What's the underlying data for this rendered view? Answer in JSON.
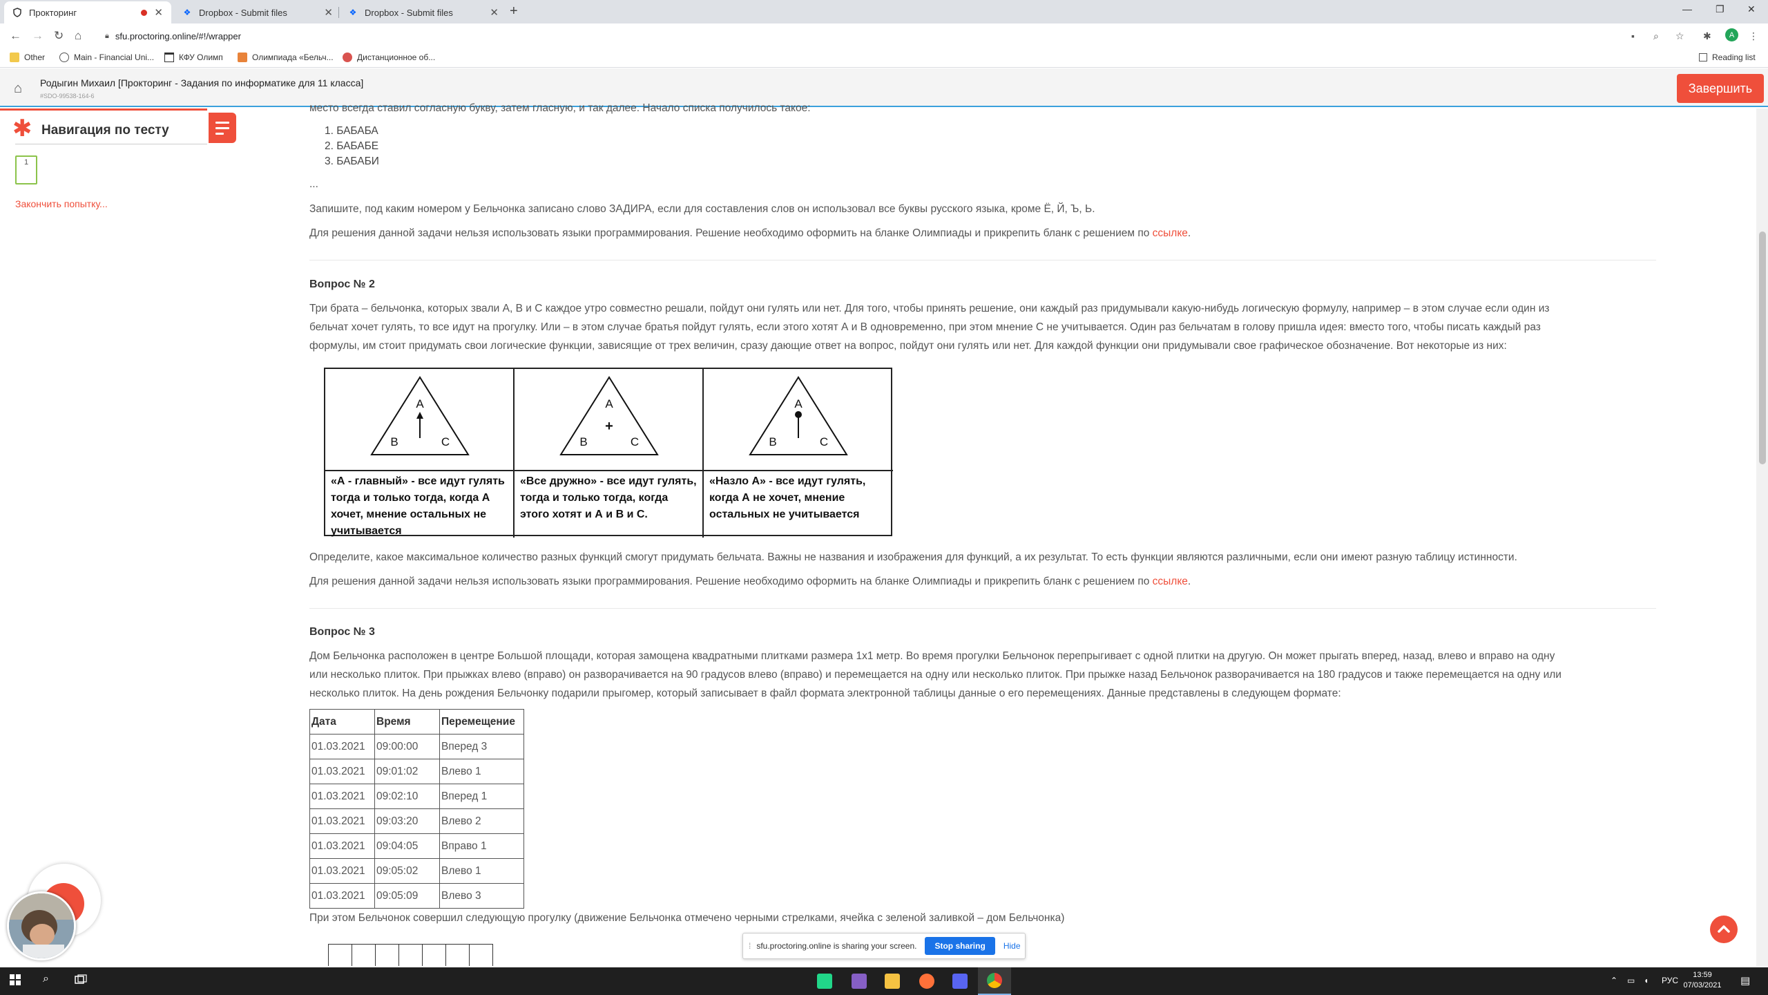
{
  "browser": {
    "tabs": [
      {
        "label": "Прокторинг",
        "icon": "shield-icon",
        "recording": true,
        "active": true
      },
      {
        "label": "Dropbox - Submit files",
        "icon": "dropbox-icon",
        "active": false
      },
      {
        "label": "Dropbox - Submit files",
        "icon": "dropbox-icon",
        "active": false
      }
    ],
    "url": "sfu.proctoring.online/#!/wrapper",
    "bookmarks": [
      {
        "label": "Other"
      },
      {
        "label": "Main - Financial Uni..."
      },
      {
        "label": "КФУ Олимп"
      },
      {
        "label": "Олимпиада «Бельч..."
      },
      {
        "label": "Дистанционное об..."
      }
    ],
    "reading_list": "Reading list",
    "profile_initial": "A"
  },
  "header": {
    "title": "Родыгин Михаил [Прокторинг - Задания по информатике для 11 класса]",
    "subtitle": "#SDO-99538-164-6",
    "finish_label": "Завершить"
  },
  "nav": {
    "title": "Навигация по тесту",
    "question_number": "1",
    "end_attempt": "Закончить попытку..."
  },
  "q1": {
    "intro_tail": "место всегда ставил согласную букву, затем гласную, и так далее. Начало списка получилось такое:",
    "list": [
      "1. БАБАБА",
      "2. БАБАБЕ",
      "3. БАБАБИ"
    ],
    "ellipsis": "...",
    "task": "Запишите, под каким номером у Бельчонка записано слово ЗАДИРА, если для составления слов он использовал все буквы русского языка, кроме Ё, Й, Ъ, Ь.",
    "note_prefix": "Для решения данной задачи нельзя использовать языки программирования. Решение необходимо оформить на бланке Олимпиады и прикрепить бланк с решением по ",
    "note_link": "ссылке",
    "note_suffix": "."
  },
  "q2": {
    "heading": "Вопрос № 2",
    "para_lines": [
      "Три брата – бельчонка, которых звали A, B и C каждое утро совместно решали, пойдут они гулять или нет. Для того, чтобы принять решение, они каждый раз придумывали какую-нибудь логическую формулу, например  – в этом случае если один из",
      "бельчат хочет гулять, то все идут на прогулку. Или  – в этом случае братья пойдут гулять, если этого хотят А и В одновременно, при этом мнение С не учитывается. Один раз бельчатам в голову пришла идея: вместо того, чтобы писать каждый раз",
      "формулы, им стоит придумать свои логические функции, зависящие от трех величин, сразу дающие ответ на вопрос, пойдут они гулять или нет. Для каждой функции они придумывали свое графическое обозначение. Вот некоторые из них:"
    ],
    "figures": [
      {
        "a": "A",
        "b": "B",
        "c": "C",
        "mark": "arrow",
        "caption": "«А - главный» - все идут гулять тогда и только тогда, когда А хочет, мнение остальных не учитывается"
      },
      {
        "a": "A",
        "b": "B",
        "c": "C",
        "mark": "+",
        "caption": "«Все дружно» - все идут гулять, тогда и только тогда, когда этого хотят и А и В и С."
      },
      {
        "a": "A",
        "b": "B",
        "c": "C",
        "mark": "dot",
        "caption": "«Назло А» - все идут гулять, когда А не хочет, мнение остальных не учитывается"
      }
    ],
    "task": "Определите, какое максимальное количество разных функций смогут придумать бельчата. Важны не названия и изображения для функций, а их результат. То есть функции являются различными, если они имеют разную таблицу истинности.",
    "note_prefix": "Для решения данной задачи нельзя использовать языки программирования. Решение необходимо оформить на бланке Олимпиады и прикрепить бланк с решением по ",
    "note_link": "ссылке",
    "note_suffix": "."
  },
  "q3": {
    "heading": "Вопрос № 3",
    "para_lines": [
      "Дом Бельчонка расположен в центре Большой площади, которая замощена квадратными плитками размера 1х1 метр. Во время прогулки Бельчонок перепрыгивает с одной плитки на другую. Он может прыгать вперед, назад, влево и вправо на одну",
      "или несколько плиток. При прыжках влево (вправо) он разворачивается на 90 градусов влево (вправо) и перемещается на одну или несколько плиток. При прыжке назад Бельчонок разворачивается на 180 градусов и также перемещается на одну или",
      "несколько плиток. На день рождения Бельчонку подарили прыгомер, который записывает в файл формата электронной таблицы данные о его перемещениях. Данные представлены в следующем формате:"
    ],
    "table": {
      "headers": [
        "Дата",
        "Время",
        "Перемещение"
      ],
      "rows": [
        [
          "01.03.2021",
          "09:00:00",
          "Вперед 3"
        ],
        [
          "01.03.2021",
          "09:01:02",
          "Влево 1"
        ],
        [
          "01.03.2021",
          "09:02:10",
          "Вперед 1"
        ],
        [
          "01.03.2021",
          "09:03:20",
          "Влево 2"
        ],
        [
          "01.03.2021",
          "09:04:05",
          "Вправо 1"
        ],
        [
          "01.03.2021",
          "09:05:02",
          "Влево 1"
        ],
        [
          "01.03.2021",
          "09:05:09",
          "Влево 3"
        ]
      ]
    },
    "after_table": "При этом Бельчонок совершил следующую прогулку (движение Бельчонка отмечено черными стрелками, ячейка с зеленой заливкой – дом Бельчонка)"
  },
  "sharing": {
    "message": "sfu.proctoring.online is sharing your screen.",
    "stop_label": "Stop sharing",
    "hide_label": "Hide"
  },
  "taskbar": {
    "time": "13:59",
    "date": "07/03/2021",
    "lang": "РУС",
    "apps": [
      {
        "name": "pycharm",
        "color": "#21d789"
      },
      {
        "name": "visual-studio",
        "color": "#865fc5"
      },
      {
        "name": "file-explorer",
        "color": "#f5c242"
      },
      {
        "name": "firefox",
        "color": "#ff7139"
      },
      {
        "name": "discord",
        "color": "#5865f2"
      },
      {
        "name": "chrome",
        "color": "#4285f4"
      }
    ]
  },
  "colors": {
    "accent": "#ef4f3b",
    "header_border": "#3aa0dc",
    "question_box": "#8bc34a"
  }
}
